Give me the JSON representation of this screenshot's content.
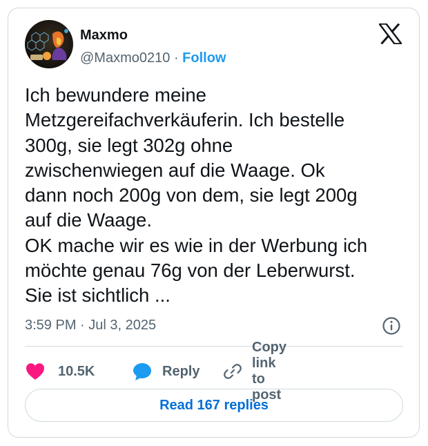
{
  "author": {
    "display_name": "Maxmo",
    "handle": "@Maxmo0210",
    "separator": "·",
    "follow_label": "Follow",
    "avatar_icon": "avatar-image"
  },
  "platform_icon": "x-logo-icon",
  "tweet": {
    "text": "Ich bewundere meine\nMetzgereifachverkäuferin. Ich bestelle\n300g, sie legt 302g ohne\nzwischenwiegen auf die Waage. Ok\ndann noch 200g von dem, sie legt 200g\nauf die Waage.\nOK mache wir es wie in der Werbung ich\nmöchte genau 76g von der Leberwurst.\nSie ist sichtlich  ...",
    "timestamp": "3:59 PM · Jul 3, 2025"
  },
  "actions": {
    "like_count": "10.5K",
    "reply_label": "Reply",
    "copy_link_label": "Copy link to post"
  },
  "read_replies_label": "Read 167 replies",
  "colors": {
    "accent": "#1d9bf0",
    "like": "#f91880",
    "secondary_text": "#536471",
    "border": "#cfd9de",
    "read_replies_text": "#006fd6"
  }
}
